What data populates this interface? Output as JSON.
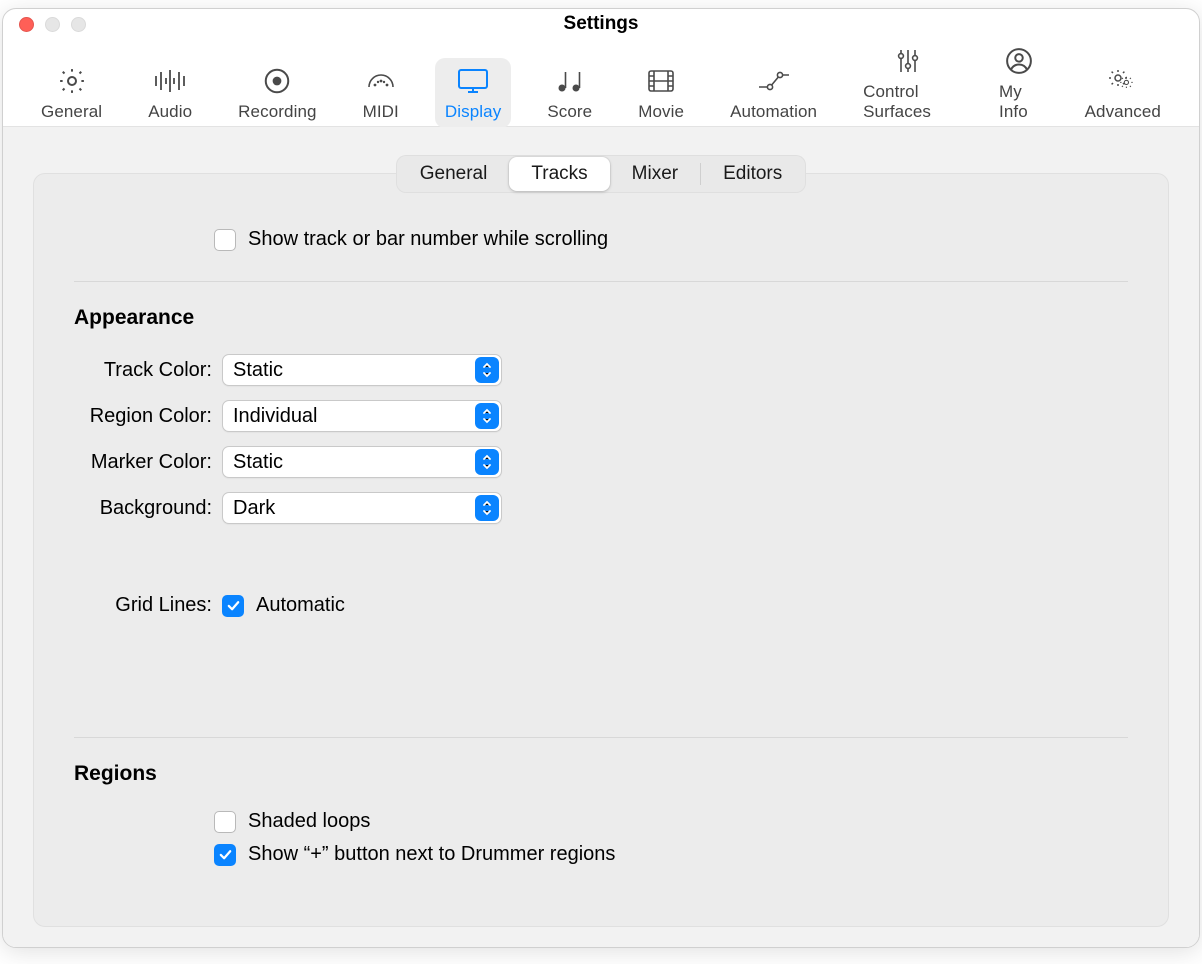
{
  "window": {
    "title": "Settings"
  },
  "toolbar": {
    "items": [
      {
        "id": "general",
        "label": "General"
      },
      {
        "id": "audio",
        "label": "Audio"
      },
      {
        "id": "recording",
        "label": "Recording"
      },
      {
        "id": "midi",
        "label": "MIDI"
      },
      {
        "id": "display",
        "label": "Display",
        "selected": true
      },
      {
        "id": "score",
        "label": "Score"
      },
      {
        "id": "movie",
        "label": "Movie"
      },
      {
        "id": "automation",
        "label": "Automation"
      },
      {
        "id": "control-surfaces",
        "label": "Control Surfaces"
      },
      {
        "id": "my-info",
        "label": "My Info"
      },
      {
        "id": "advanced",
        "label": "Advanced"
      }
    ]
  },
  "tabs": {
    "items": [
      {
        "id": "general",
        "label": "General"
      },
      {
        "id": "tracks",
        "label": "Tracks",
        "selected": true
      },
      {
        "id": "mixer",
        "label": "Mixer"
      },
      {
        "id": "editors",
        "label": "Editors"
      }
    ]
  },
  "option_show_number": {
    "label": "Show track or bar number while scrolling",
    "checked": false
  },
  "section_appearance": {
    "title": "Appearance"
  },
  "appearance": {
    "track_color": {
      "label": "Track Color:",
      "value": "Static"
    },
    "region_color": {
      "label": "Region Color:",
      "value": "Individual"
    },
    "marker_color": {
      "label": "Marker Color:",
      "value": "Static"
    },
    "background": {
      "label": "Background:",
      "value": "Dark"
    },
    "grid_lines": {
      "label": "Grid Lines:",
      "checkbox_label": "Automatic",
      "checked": true
    }
  },
  "section_regions": {
    "title": "Regions"
  },
  "regions": {
    "shaded_loops": {
      "label": "Shaded loops",
      "checked": false
    },
    "show_plus": {
      "label": "Show “+” button next to Drummer regions",
      "checked": true
    }
  }
}
